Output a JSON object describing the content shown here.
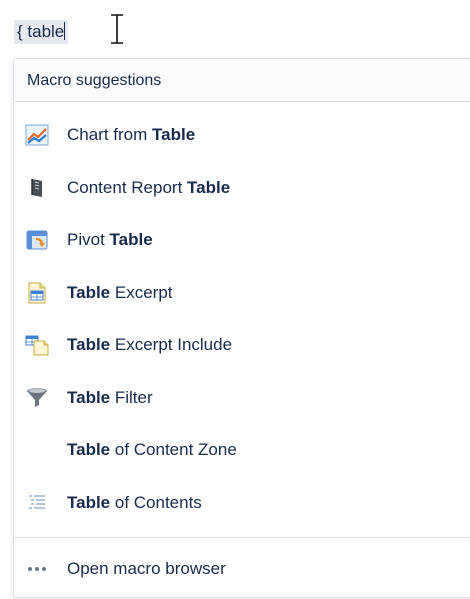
{
  "editor": {
    "typed_text": "{ table"
  },
  "dropdown": {
    "header": "Macro suggestions",
    "items": [
      {
        "pre": "Chart from ",
        "bold": "Table",
        "post": "",
        "icon": "chart-icon"
      },
      {
        "pre": "Content Report ",
        "bold": "Table",
        "post": "",
        "icon": "content-report-icon"
      },
      {
        "pre": "Pivot ",
        "bold": "Table",
        "post": "",
        "icon": "pivot-table-icon"
      },
      {
        "pre": "",
        "bold": "Table",
        "post": " Excerpt",
        "icon": "table-excerpt-icon"
      },
      {
        "pre": "",
        "bold": "Table",
        "post": " Excerpt Include",
        "icon": "table-excerpt-include-icon"
      },
      {
        "pre": "",
        "bold": "Table",
        "post": " Filter",
        "icon": "filter-icon"
      },
      {
        "pre": "",
        "bold": "Table",
        "post": " of Content Zone",
        "icon": ""
      },
      {
        "pre": "",
        "bold": "Table",
        "post": " of Contents",
        "icon": "toc-icon"
      }
    ],
    "footer": "Open macro browser"
  }
}
